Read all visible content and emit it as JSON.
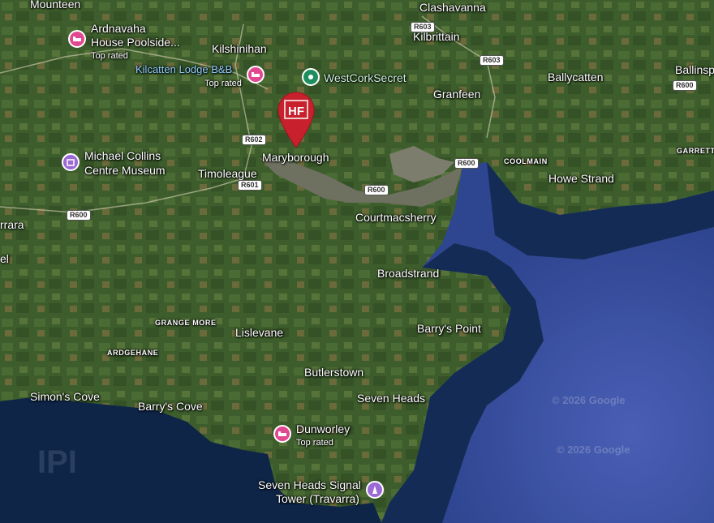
{
  "map": {
    "colors": {
      "land": "#3f5f2e",
      "sea_deep": "#0f2a4f",
      "sea_open": "#3f55a8",
      "estuary": "#7a7a6a",
      "marker": "#c8202c"
    },
    "places": {
      "mounteen": "Mounteen",
      "ardnavaha_1": "Ardnavaha",
      "ardnavaha_2": "House Poolside...",
      "ardnavaha_sub": "Top rated",
      "kilshinihan": "Kilshinihan",
      "kilcatten": "Kilcatten Lodge B&B",
      "kilcatten_sub": "Top rated",
      "westcork": "WestCorkSecret",
      "clashavanna": "Clashavanna",
      "kilbrittain": "Kilbrittain",
      "ballycatten": "Ballycatten",
      "ballinsp": "Ballinsp",
      "granfeen": "Granfeen",
      "michael_1": "Michael Collins",
      "michael_2": "Centre Museum",
      "maryborough": "Maryborough",
      "timoleague": "Timoleague",
      "coolmain": "COOLMAIN",
      "howe_strand": "Howe Strand",
      "garrett": "GARRETT",
      "arrara": "rrara",
      "el": "el",
      "courtmacsherry": "Courtmacsherry",
      "broadstrand": "Broadstrand",
      "grange_more": "GRANGE MORE",
      "lislevane": "Lislevane",
      "barrys_point": "Barry's Point",
      "ardgehane": "ARDGEHANE",
      "butlerstown": "Butlerstown",
      "seven_heads": "Seven Heads",
      "simons_cove": "Simon's Cove",
      "barrys_cove": "Barry's Cove",
      "dunworley": "Dunworley",
      "dunworley_sub": "Top rated",
      "signal_1": "Seven Heads Signal",
      "signal_2": "Tower (Travarra)"
    },
    "roads": {
      "r603a": "R603",
      "r603b": "R603",
      "r600a": "R600",
      "r602": "R602",
      "r601": "R601",
      "r600b": "R600",
      "r600c": "R600",
      "r600d": "R600"
    },
    "marker_label": "HF",
    "watermark_1": "© 2026 Google",
    "watermark_2": "© 2026 Google"
  }
}
